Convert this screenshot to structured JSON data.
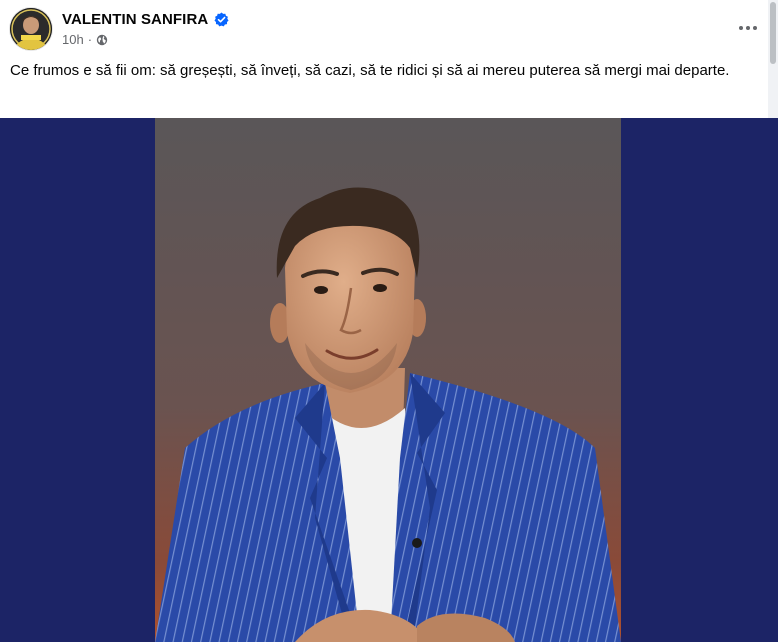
{
  "post": {
    "author_name": "VALENTIN SANFIRA",
    "verified_icon": "verified-badge-icon",
    "timestamp": "10h",
    "separator": "·",
    "audience_icon": "globe-icon",
    "more_icon": "more-options-icon",
    "caption": "Ce frumos e să fii om: să greșești, să înveți, să cazi, să te ridici și să ai mereu puterea să mergi mai departe.",
    "photo_alt": "Portrait photo of a smiling man in a blue pinstripe blazer and white t-shirt"
  },
  "colors": {
    "author": "#050505",
    "meta": "#65676b",
    "verified": "#0866ff",
    "media_background": "#1c2466",
    "blazer": "#2a4aa8"
  }
}
